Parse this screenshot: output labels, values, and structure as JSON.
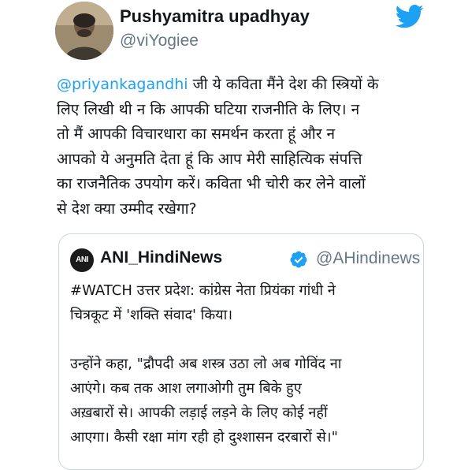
{
  "tweet": {
    "author_name": "Pushyamitra upadhyay",
    "author_handle": "@viYogiee",
    "icon": "twitter-bird-icon",
    "brand_color": "#1da1f2",
    "mention": "@priyankagandhi",
    "lines": [
      " जी ये कविता मैंने देश की स्त्रियों के",
      "लिए लिखी थी न कि आपकी घटिया राजनीति के लिए। न",
      "तो मैं आपकी विचारधारा का समर्थन करता हूं और न",
      "आपको ये अनुमति देता हूं कि आप मेरी साहित्यिक संपत्ति",
      "का राजनैतिक उपयोग करें। कविता भी चोरी कर लेने वालों",
      "से देश क्या उम्मीद रखेगा?"
    ]
  },
  "quoted": {
    "avatar_text": "ANI",
    "author_name": "ANI_HindiNews",
    "verified_icon": "verified-badge-icon",
    "author_handle": "@AHindinews",
    "lines": [
      "#WATCH उत्तर प्रदेश: कांग्रेस नेता प्रियंका गांधी ने",
      "चित्रकूट में 'शक्ति संवाद' किया।",
      "",
      "उन्होंने कहा, \"द्रौपदी अब शस्त्र उठा लो अब गोविंद ना",
      "आएंगे। कब तक आश लगाओगी तुम बिके हुए",
      "अख़बारों से। आपकी लड़ाई लड़ने के लिए कोई नहीं",
      "आएगा। कैसी रक्षा मांग रही हो दुश्शासन दरबारों से।\""
    ]
  }
}
